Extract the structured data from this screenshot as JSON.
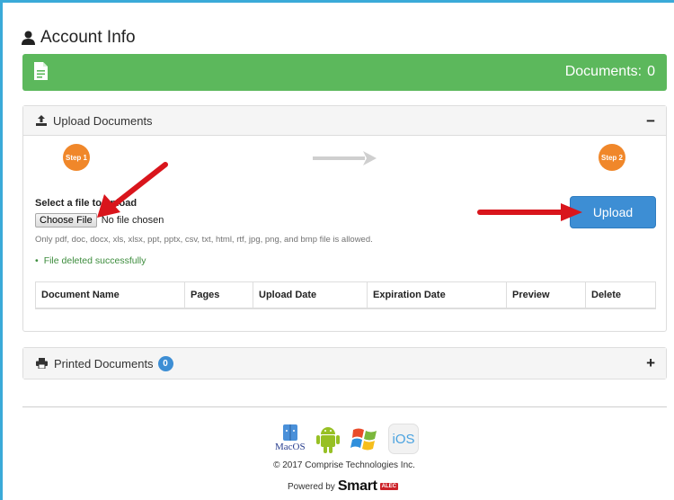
{
  "page": {
    "title": "Account Info"
  },
  "documents_bar": {
    "label": "Documents:",
    "count": "0"
  },
  "upload_panel": {
    "title": "Upload Documents",
    "toggle": "−",
    "step1": "Step 1",
    "step2": "Step 2",
    "select_label": "Select a file to upload",
    "choose_button": "Choose File",
    "file_status": "No file chosen",
    "allowed_text": "Only pdf, doc, docx, xls, xlsx, ppt, pptx, csv, txt, html, rtf, jpg, png, and bmp file is allowed.",
    "success_message": "File deleted successfully",
    "upload_button": "Upload",
    "table_headers": [
      "Document Name",
      "Pages",
      "Upload Date",
      "Expiration Date",
      "Preview",
      "Delete"
    ]
  },
  "printed_panel": {
    "title": "Printed Documents",
    "badge": "0",
    "toggle": "+"
  },
  "footer": {
    "platforms": [
      "MacOS",
      "Android",
      "Windows",
      "iOS"
    ],
    "copyright": "© 2017 Comprise Technologies Inc.",
    "powered_by": "Powered by",
    "brand": "Smart",
    "brand_tag": "ALEC"
  },
  "colors": {
    "success_green": "#5cb85c",
    "primary_blue": "#3d8ed4",
    "step_orange": "#f0872a",
    "annotation_red": "#d9151c"
  }
}
